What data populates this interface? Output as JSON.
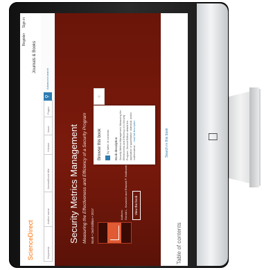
{
  "app": {
    "logo": "ScienceDirect",
    "top_links": [
      "Register",
      "Sign in"
    ],
    "journals_link": "Journals & Books"
  },
  "search": {
    "keywords_placeholder": "Keywords",
    "author_placeholder": "Author name",
    "journal_placeholder": "Journal/book title",
    "volume_placeholder": "Volume",
    "issue_placeholder": "Issue",
    "pages_placeholder": "Pages",
    "advanced": "Advanced search"
  },
  "book": {
    "title": "Security Metrics Management",
    "subtitle": "Measuring the Effectiveness and Efficiency of a Security Program",
    "meta": "Book • 2nd Edition • 2017",
    "authors": "Authors:",
    "author_names": "Gerald L. Kovacich and Edward P. Halibozek",
    "view_button": "View the book"
  },
  "card": {
    "title": "Browse this book",
    "by_table": "By table of contents",
    "desc_heading": "Book description",
    "desc": "Security Metrics Management, Measuring the Effectiveness and Efficiency of a Security Program, Second Edition details the application of quantitative, statistical, and/or mathematical ...",
    "read_more": "read full description",
    "search_button": "Search in this book"
  },
  "sections": {
    "toc": "Table of contents"
  },
  "colors": {
    "hero": "#6a1509",
    "accent": "#2e7cb1",
    "logo": "#ff6c00"
  }
}
